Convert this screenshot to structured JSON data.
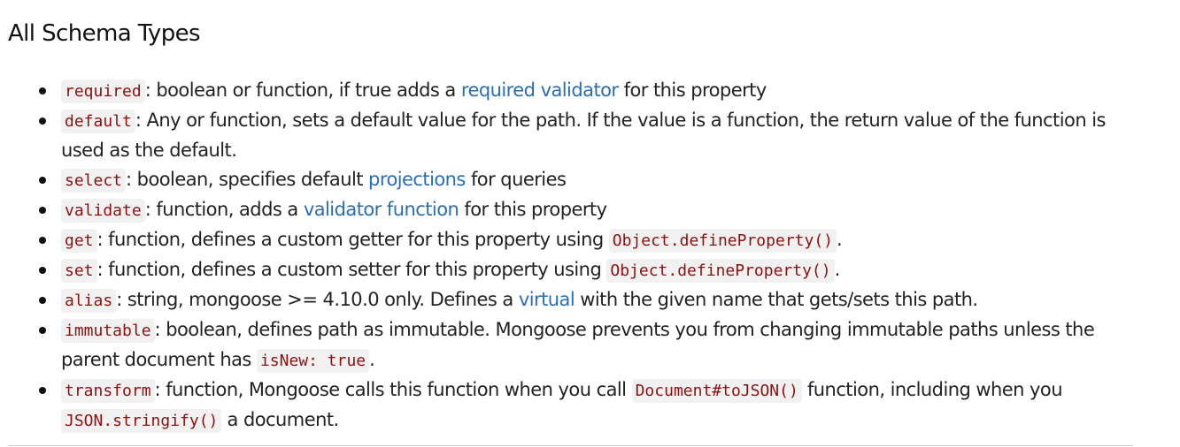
{
  "title": "All Schema Types",
  "items": [
    {
      "code": "required",
      "t1": ": boolean or function, if true adds a ",
      "link": "required validator",
      "t2": " for this property"
    },
    {
      "code": "default",
      "t1": ": Any or function, sets a default value for the path. If the value is a function, the return value of the function is used as the default."
    },
    {
      "code": "select",
      "t1": ": boolean, specifies default ",
      "link": "projections",
      "t2": " for queries"
    },
    {
      "code": "validate",
      "t1": ": function, adds a ",
      "link": "validator function",
      "t2": " for this property"
    },
    {
      "code": "get",
      "t1": ": function, defines a custom getter for this property using ",
      "code2": "Object.defineProperty()",
      "t2": "."
    },
    {
      "code": "set",
      "t1": ": function, defines a custom setter for this property using ",
      "code2": "Object.defineProperty()",
      "t2": "."
    },
    {
      "code": "alias",
      "t1": ": string, mongoose >= 4.10.0 only. Defines a ",
      "link": "virtual",
      "t2": " with the given name that gets/sets this path."
    },
    {
      "code": "immutable",
      "t1": ": boolean, defines path as immutable. Mongoose prevents you from changing immutable paths unless the parent document has ",
      "code2": "isNew: true",
      "t2": "."
    },
    {
      "code": "transform",
      "t1": ": function, Mongoose calls this function when you call ",
      "code2": "Document#toJSON()",
      "t2": " function, including when you ",
      "code3": "JSON.stringify()",
      "t3": " a document."
    }
  ]
}
